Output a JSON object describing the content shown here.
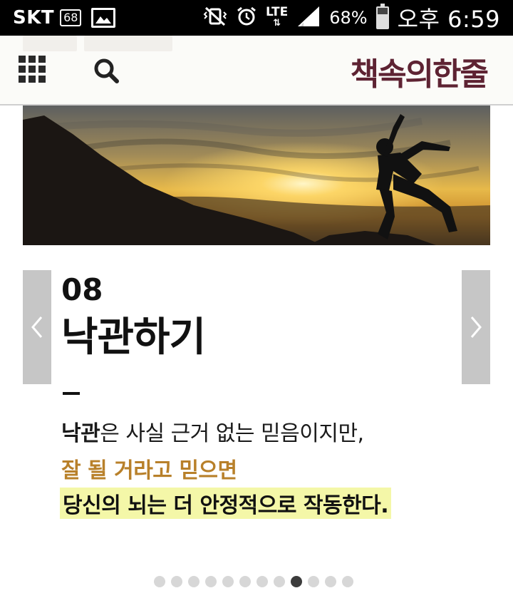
{
  "status_bar": {
    "carrier": "SKT",
    "badge": "68",
    "network": "LTE",
    "battery_percent": "68%",
    "time": "오후 6:59"
  },
  "header": {
    "menu_icon": "grid-menu-icon",
    "search_icon": "search-icon",
    "logo": "책속의한줄"
  },
  "slide": {
    "number": "08",
    "title": "낙관하기",
    "line1_bold": "낙관",
    "line1_rest": "은 사실 근거 없는 믿음이지만,",
    "line2": "잘 될 거라고 믿으면",
    "line3": "당신의 뇌는 더 안정적으로 작동한다.",
    "accent_color": "#b8802a",
    "highlight_color": "#f4f7a8"
  },
  "pagination": {
    "total": 12,
    "active_index": 8
  },
  "nav": {
    "prev_icon": "chevron-left-icon",
    "next_icon": "chevron-right-icon"
  }
}
